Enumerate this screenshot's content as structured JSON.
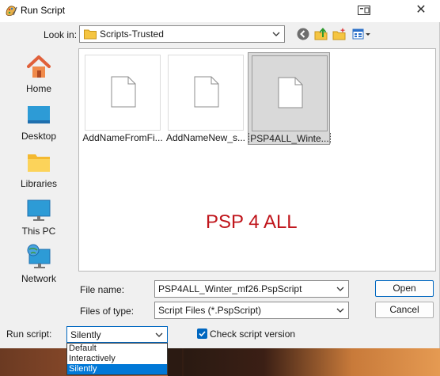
{
  "window": {
    "title": "Run Script"
  },
  "lookin": {
    "label": "Look in:",
    "value": "Scripts-Trusted"
  },
  "places": [
    {
      "label": "Home",
      "icon": "home-icon"
    },
    {
      "label": "Desktop",
      "icon": "desktop-icon"
    },
    {
      "label": "Libraries",
      "icon": "libraries-icon"
    },
    {
      "label": "This PC",
      "icon": "this-pc-icon"
    },
    {
      "label": "Network",
      "icon": "network-icon"
    }
  ],
  "files": [
    {
      "name": "AddNameFromFi...",
      "selected": false
    },
    {
      "name": "AddNameNew_s...",
      "selected": false
    },
    {
      "name": "PSP4ALL_Winte...",
      "selected": true
    }
  ],
  "watermark": "PSP 4 ALL",
  "filename": {
    "label": "File name:",
    "value": "PSP4ALL_Winter_mf26.PspScript"
  },
  "filetype": {
    "label": "Files of type:",
    "value": "Script Files (*.PspScript)"
  },
  "buttons": {
    "open": "Open",
    "cancel": "Cancel"
  },
  "run_script": {
    "label": "Run script:",
    "value": "Silently",
    "options": [
      "Default",
      "Interactively",
      "Silently"
    ],
    "selected_index": 2
  },
  "check_version": {
    "label": "Check script version",
    "checked": true
  },
  "colors": {
    "accent": "#0067c0",
    "selection": "#0078d7",
    "watermark": "#c0161c"
  }
}
